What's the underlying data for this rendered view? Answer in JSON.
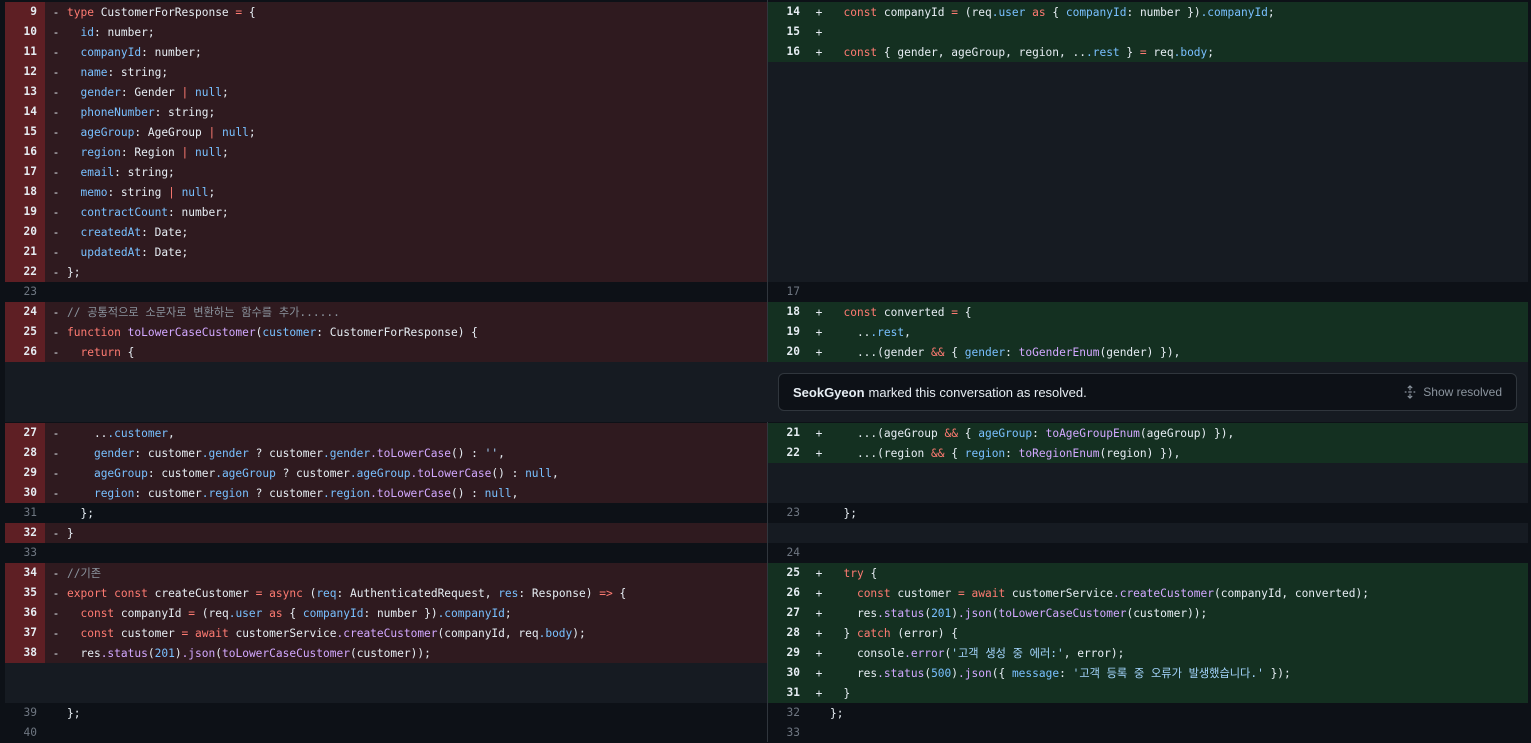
{
  "resolved": {
    "user": "SeokGyeon",
    "message": "marked this conversation as resolved.",
    "action": "Show resolved",
    "icon": "unfold-icon"
  },
  "left": [
    {
      "n": "9",
      "t": "del",
      "c": "type CustomerForResponse = {"
    },
    {
      "n": "10",
      "t": "del",
      "c": "  id: number;"
    },
    {
      "n": "11",
      "t": "del",
      "c": "  companyId: number;"
    },
    {
      "n": "12",
      "t": "del",
      "c": "  name: string;"
    },
    {
      "n": "13",
      "t": "del",
      "c": "  gender: Gender | null;"
    },
    {
      "n": "14",
      "t": "del",
      "c": "  phoneNumber: string;"
    },
    {
      "n": "15",
      "t": "del",
      "c": "  ageGroup: AgeGroup | null;"
    },
    {
      "n": "16",
      "t": "del",
      "c": "  region: Region | null;"
    },
    {
      "n": "17",
      "t": "del",
      "c": "  email: string;"
    },
    {
      "n": "18",
      "t": "del",
      "c": "  memo: string | null;"
    },
    {
      "n": "19",
      "t": "del",
      "c": "  contractCount: number;"
    },
    {
      "n": "20",
      "t": "del",
      "c": "  createdAt: Date;"
    },
    {
      "n": "21",
      "t": "del",
      "c": "  updatedAt: Date;"
    },
    {
      "n": "22",
      "t": "del",
      "c": "};"
    },
    {
      "n": "23",
      "t": "ctx",
      "c": ""
    },
    {
      "n": "24",
      "t": "del",
      "c": "// 공통적으로 소문자로 변환하는 함수를 추가......"
    },
    {
      "n": "25",
      "t": "del",
      "c": "function toLowerCaseCustomer(customer: CustomerForResponse) {"
    },
    {
      "n": "26",
      "t": "del",
      "c": "  return {"
    },
    {
      "n": "27",
      "t": "del",
      "c": "    ...customer,"
    },
    {
      "n": "28",
      "t": "del",
      "c": "    gender: customer.gender ? customer.gender.toLowerCase() : '',"
    },
    {
      "n": "29",
      "t": "del",
      "c": "    ageGroup: customer.ageGroup ? customer.ageGroup.toLowerCase() : null,"
    },
    {
      "n": "30",
      "t": "del",
      "c": "    region: customer.region ? customer.region.toLowerCase() : null,"
    },
    {
      "n": "31",
      "t": "ctx",
      "c": "  };"
    },
    {
      "n": "32",
      "t": "del",
      "c": "}"
    },
    {
      "n": "33",
      "t": "ctx",
      "c": ""
    },
    {
      "n": "34",
      "t": "del",
      "c": "//기존"
    },
    {
      "n": "35",
      "t": "del",
      "c": "export const createCustomer = async (req: AuthenticatedRequest, res: Response) => {"
    },
    {
      "n": "36",
      "t": "del",
      "c": "  const companyId = (req.user as { companyId: number }).companyId;"
    },
    {
      "n": "37",
      "t": "del",
      "c": "  const customer = await customerService.createCustomer(companyId, req.body);"
    },
    {
      "n": "38",
      "t": "del",
      "c": "  res.status(201).json(toLowerCaseCustomer(customer));"
    },
    {
      "n": "39",
      "t": "ctx",
      "c": "};"
    },
    {
      "n": "40",
      "t": "ctx",
      "c": ""
    }
  ],
  "right": [
    {
      "n": "14",
      "t": "add",
      "c": "  const companyId = (req.user as { companyId: number }).companyId;"
    },
    {
      "n": "15",
      "t": "add",
      "c": ""
    },
    {
      "n": "16",
      "t": "add",
      "c": "  const { gender, ageGroup, region, ...rest } = req.body;"
    },
    {
      "n": "17",
      "t": "ctx",
      "c": ""
    },
    {
      "n": "18",
      "t": "add",
      "c": "  const converted = {"
    },
    {
      "n": "19",
      "t": "add",
      "c": "    ...rest,"
    },
    {
      "n": "20",
      "t": "add",
      "c": "    ...(gender && { gender: toGenderEnum(gender) }),"
    },
    {
      "n": "21",
      "t": "add",
      "c": "    ...(ageGroup && { ageGroup: toAgeGroupEnum(ageGroup) }),"
    },
    {
      "n": "22",
      "t": "add",
      "c": "    ...(region && { region: toRegionEnum(region) }),"
    },
    {
      "n": "23",
      "t": "ctx",
      "c": "  };"
    },
    {
      "n": "24",
      "t": "ctx",
      "c": ""
    },
    {
      "n": "25",
      "t": "add",
      "c": "  try {"
    },
    {
      "n": "26",
      "t": "add",
      "c": "    const customer = await customerService.createCustomer(companyId, converted);"
    },
    {
      "n": "27",
      "t": "add",
      "c": "    res.status(201).json(toLowerCaseCustomer(customer));"
    },
    {
      "n": "28",
      "t": "add",
      "c": "  } catch (error) {"
    },
    {
      "n": "29",
      "t": "add",
      "c": "    console.error('고객 생성 중 에러:', error);"
    },
    {
      "n": "30",
      "t": "add",
      "c": "    res.status(500).json({ message: '고객 등록 중 오류가 발생했습니다.' });"
    },
    {
      "n": "31",
      "t": "add",
      "c": "  }"
    },
    {
      "n": "32",
      "t": "ctx",
      "c": "};"
    },
    {
      "n": "33",
      "t": "ctx",
      "c": ""
    }
  ],
  "colors": {
    "deleted_bg": "#2f1a1f",
    "added_bg": "#143021",
    "deleted_num_bg": "#5e1f24",
    "filler": "#161b22"
  }
}
